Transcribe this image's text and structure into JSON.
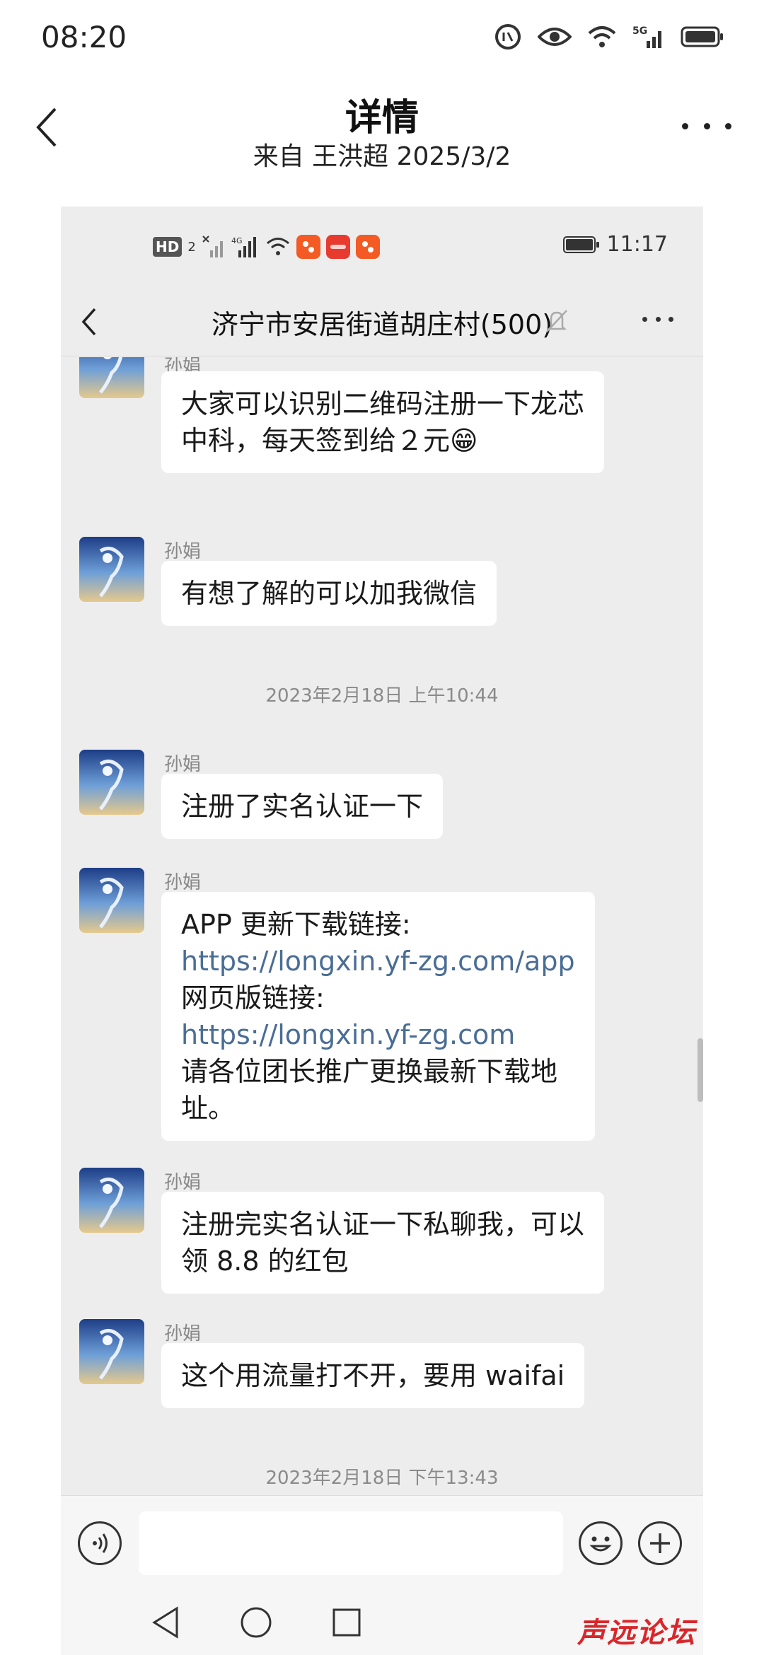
{
  "status_bar": {
    "time": "08:20",
    "network": "5G",
    "icons": [
      "data-saver-icon",
      "eye-icon",
      "wifi-icon",
      "signal-icon",
      "battery-icon"
    ]
  },
  "header": {
    "title": "详情",
    "subtitle": "来自 王洪超 2025/3/2"
  },
  "inner": {
    "status": {
      "time": "11:17",
      "hd_label": "HD",
      "hd_sub": "2"
    },
    "chat": {
      "title": "济宁市安居街道胡庄村(500)"
    },
    "messages": [
      {
        "sender": "孙娟",
        "lines": [
          "大家可以识别二维码注册一下龙芯",
          "中科，每天签到给２元😁"
        ]
      },
      {
        "sender": "孙娟",
        "lines": [
          "有想了解的可以加我微信"
        ]
      },
      {
        "sender": "孙娟",
        "lines": [
          "注册了实名认证一下"
        ]
      },
      {
        "sender": "孙娟",
        "lines": [
          "APP 更新下载链接:",
          "https://longxin.yf-zg.com/app",
          "网页版链接:",
          "https://longxin.yf-zg.com",
          "请各位团长推广更换最新下载地",
          "址。"
        ]
      },
      {
        "sender": "孙娟",
        "lines": [
          "注册完实名认证一下私聊我，可以",
          "领 8.8 的红包"
        ]
      },
      {
        "sender": "孙娟",
        "lines": [
          "这个用流量打不开，要用 waifai"
        ]
      }
    ],
    "timestamps": [
      "2023年2月18日 上午10:44",
      "2023年2月18日 下午13:43"
    ]
  },
  "watermark": "声远论坛",
  "colors": {
    "chat_bg": "#ededed",
    "bubble": "#ffffff",
    "link": "#4a6d95",
    "watermark": "#d8262a"
  }
}
